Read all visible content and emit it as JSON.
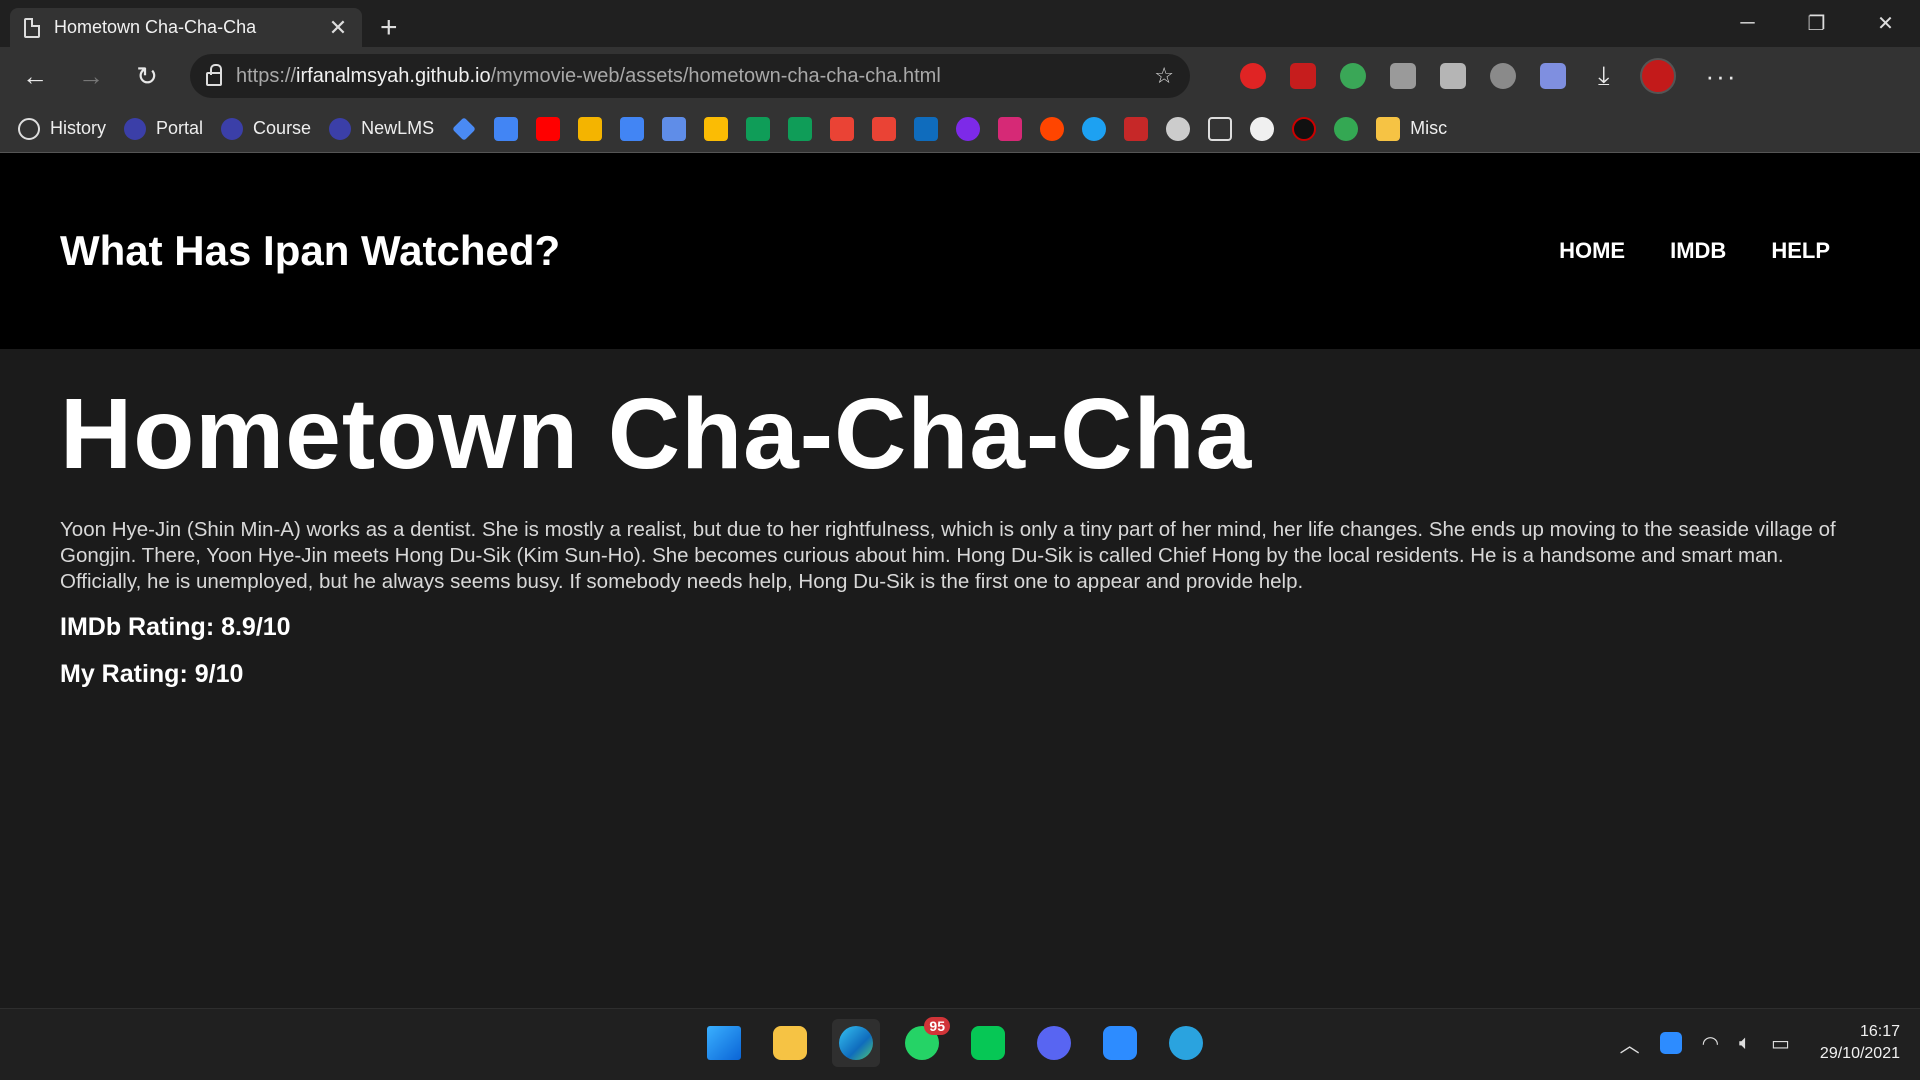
{
  "browser": {
    "tab_title": "Hometown Cha-Cha-Cha",
    "url_prefix": "https://",
    "url_host": "irfanalmsyah.github.io",
    "url_path": "/mymovie-web/assets/hometown-cha-cha-cha.html",
    "bookmarks": [
      {
        "label": "History"
      },
      {
        "label": "Portal"
      },
      {
        "label": "Course"
      },
      {
        "label": "NewLMS"
      }
    ],
    "bookmark_folder": "Misc"
  },
  "site": {
    "title": "What Has Ipan Watched?",
    "nav": {
      "home": "HOME",
      "imdb": "IMDB",
      "help": "HELP"
    }
  },
  "movie": {
    "title": "Hometown Cha-Cha-Cha",
    "synopsis": "Yoon Hye-Jin (Shin Min-A) works as a dentist. She is mostly a realist, but due to her rightfulness, which is only a tiny part of her mind, her life changes. She ends up moving to the seaside village of Gongjin. There, Yoon Hye-Jin meets Hong Du-Sik (Kim Sun-Ho). She becomes curious about him. Hong Du-Sik is called Chief Hong by the local residents. He is a handsome and smart man. Officially, he is unemployed, but he always seems busy. If somebody needs help, Hong Du-Sik is the first one to appear and provide help.",
    "imdb_rating": "IMDb Rating: 8.9/10",
    "my_rating": "My Rating: 9/10"
  },
  "taskbar": {
    "whatsapp_badge": "95",
    "time": "16:17",
    "date": "29/10/2021"
  }
}
